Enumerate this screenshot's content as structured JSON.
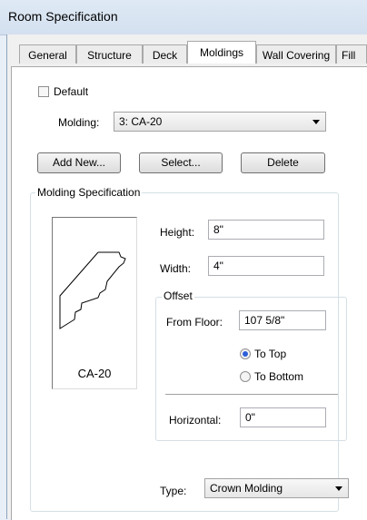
{
  "window": {
    "title": "Room Specification"
  },
  "tabs": [
    {
      "label": "General"
    },
    {
      "label": "Structure"
    },
    {
      "label": "Deck"
    },
    {
      "label": "Moldings"
    },
    {
      "label": "Wall Covering"
    },
    {
      "label": "Fill"
    }
  ],
  "active_tab": "Moldings",
  "default_checkbox": {
    "label": "Default",
    "checked": false
  },
  "molding_select": {
    "label": "Molding:",
    "value": "3:  CA-20"
  },
  "buttons": {
    "add_new": "Add New...",
    "select": "Select...",
    "delete": "Delete"
  },
  "spec": {
    "legend": "Molding Specification",
    "preview_caption": "CA-20",
    "height_label": "Height:",
    "height_value": "8\"",
    "width_label": "Width:",
    "width_value": "4\"",
    "offset": {
      "legend": "Offset",
      "from_floor_label": "From Floor:",
      "from_floor_value": "107 5/8\"",
      "to_top": "To Top",
      "to_bottom": "To Bottom",
      "selected": "To Top",
      "horizontal_label": "Horizontal:",
      "horizontal_value": "0\""
    },
    "type_label": "Type:",
    "type_value": "Crown Molding"
  }
}
